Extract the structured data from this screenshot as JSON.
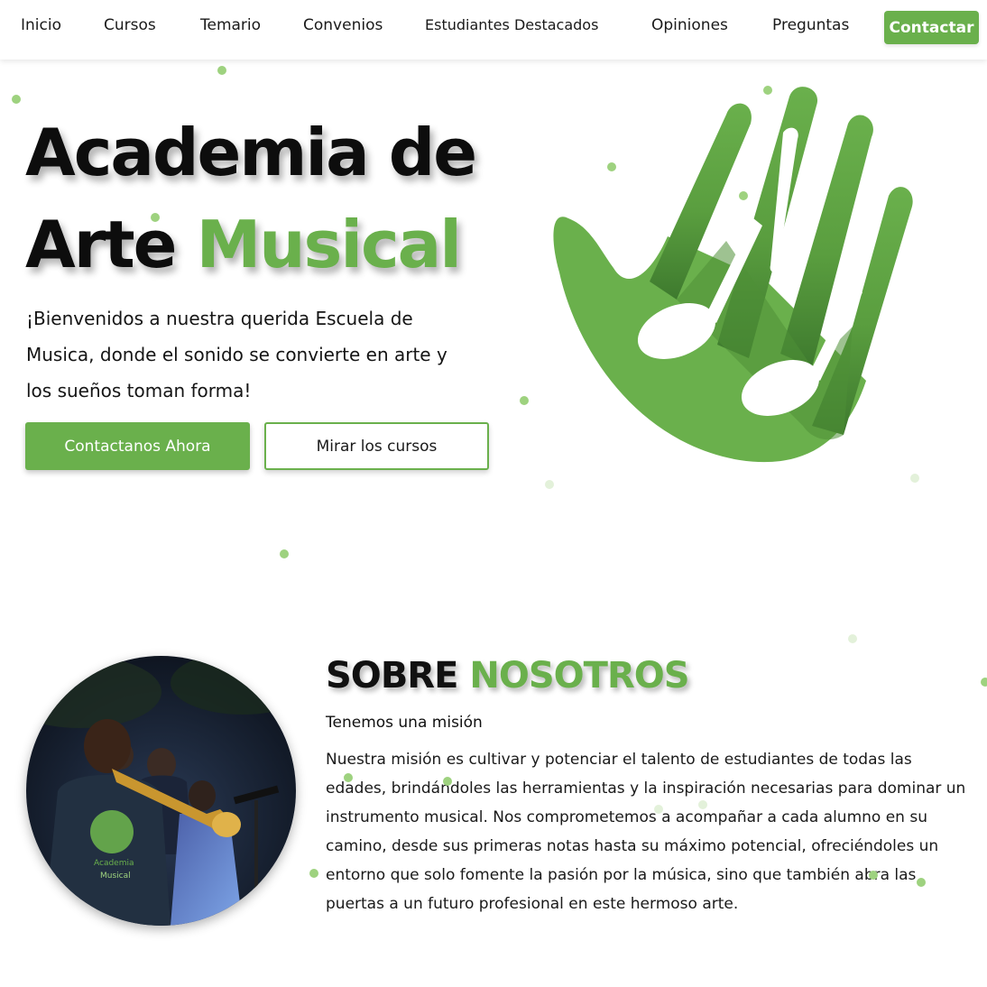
{
  "nav": {
    "links": [
      "Inicio",
      "Cursos",
      "Temario",
      "Convenios",
      "Estudiantes Destacados",
      "Opiniones",
      "Preguntas"
    ],
    "cta": "Contactar"
  },
  "hero": {
    "title_line1": "Academia de",
    "title_line2_black": "Arte",
    "title_line2_green": "Musical",
    "subtitle": "¡Bienvenidos a nuestra querida Escuela de Musica, donde el sonido se convierte en arte y los sueños toman forma!",
    "btn_primary": "Contactanos Ahora",
    "btn_secondary": "Mirar los cursos",
    "logo_icon": "hand-music-note-logo-icon"
  },
  "about": {
    "title_black": "SOBRE",
    "title_green": "NOSOTROS",
    "subtitle": "Tenemos una misión",
    "body": "Nuestra misión es cultivar y potenciar el talento de estudiantes de todas las edades, brindándoles las herramientas y la inspiración necesarias para dominar un instrumento musical. Nos comprometemos a acompañar a cada alumno en su camino, desde sus primeras notas hasta su máximo potencial, ofreciéndoles un entorno que solo fomente la pasión por la música, sino que también abra las puertas a un futuro profesional en este hermoso arte.",
    "photo_shirt_text": "Academia de Arte Musical"
  },
  "colors": {
    "accent": "#6ab04c",
    "dark_green": "#3e7a2e",
    "text": "#111111"
  }
}
